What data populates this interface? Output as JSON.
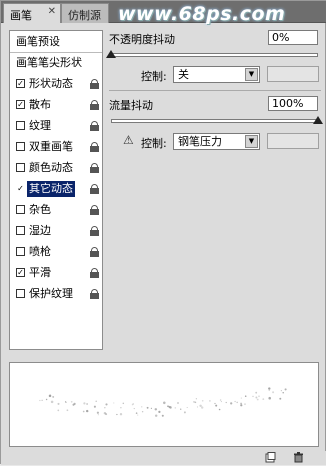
{
  "tabs": [
    {
      "label": "画笔"
    },
    {
      "label": "仿制源"
    }
  ],
  "watermark": "www.68ps.com",
  "sidebar": {
    "header": "画笔预设",
    "tip_shape": "画笔笔尖形状",
    "items": [
      {
        "label": "形状动态",
        "checked": true,
        "locked": true
      },
      {
        "label": "散布",
        "checked": true,
        "locked": true
      },
      {
        "label": "纹理",
        "checked": false,
        "locked": true
      },
      {
        "label": "双重画笔",
        "checked": false,
        "locked": true
      },
      {
        "label": "颜色动态",
        "checked": false,
        "locked": true
      },
      {
        "label": "其它动态",
        "checked": true,
        "locked": true,
        "selected": true
      },
      {
        "label": "杂色",
        "checked": false,
        "locked": true
      },
      {
        "label": "湿边",
        "checked": false,
        "locked": true
      },
      {
        "label": "喷枪",
        "checked": false,
        "locked": true
      },
      {
        "label": "平滑",
        "checked": true,
        "locked": true
      },
      {
        "label": "保护纹理",
        "checked": false,
        "locked": true
      }
    ]
  },
  "opacity_jitter": {
    "label": "不透明度抖动",
    "value": "0%",
    "control_label": "控制:",
    "control_value": "关"
  },
  "flow_jitter": {
    "label": "流量抖动",
    "value": "100%",
    "control_label": "控制:",
    "control_value": "钢笔压力"
  },
  "check_mark": "✓",
  "warning_icon": "⚠",
  "dropdown_arrow": "▼"
}
